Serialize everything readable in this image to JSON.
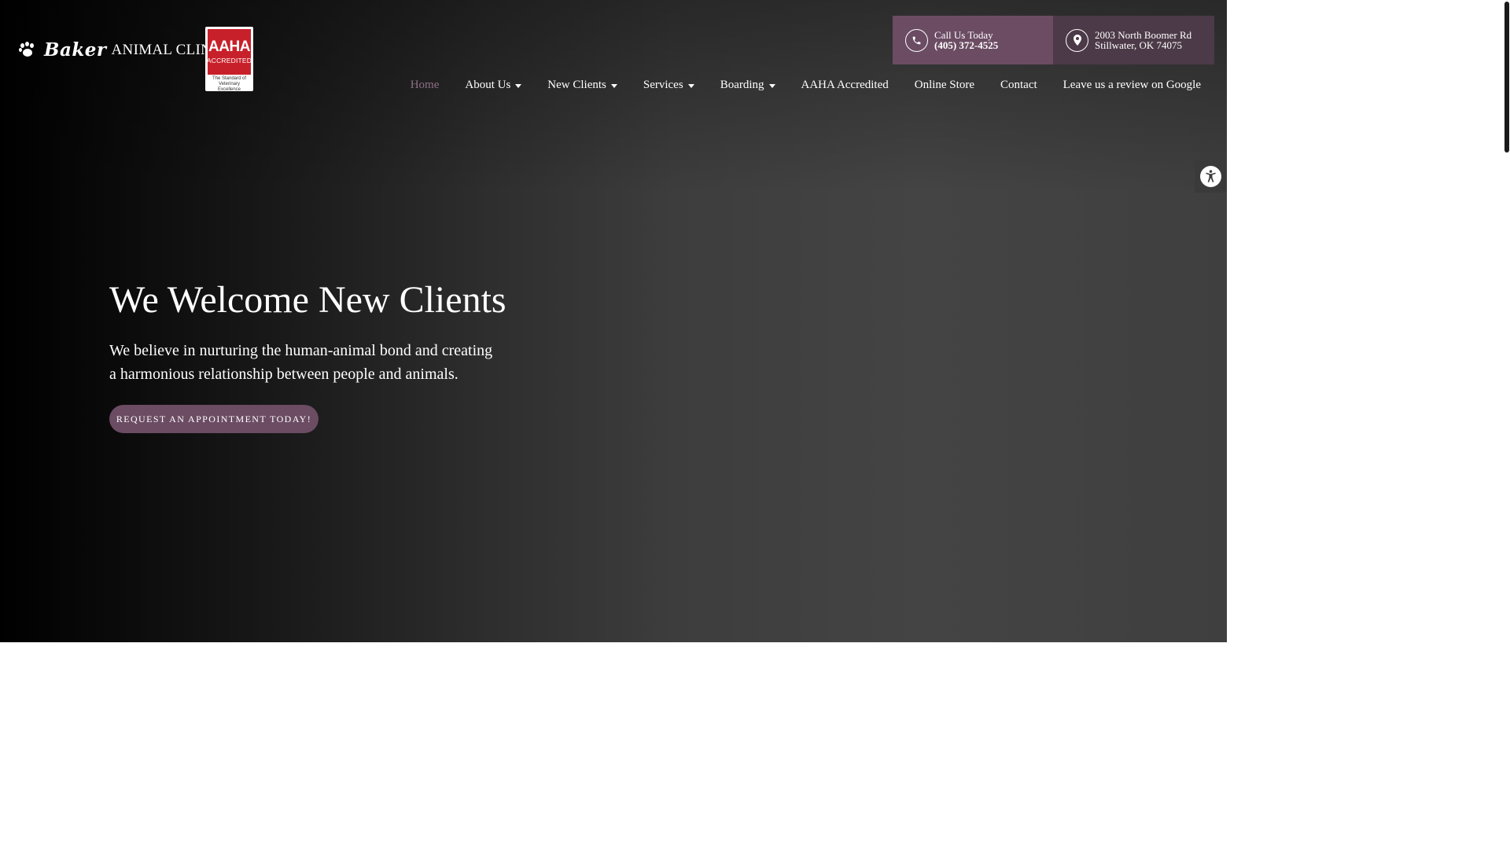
{
  "logo": {
    "script": "Baker",
    "text": "ANIMAL CLINIC",
    "badge_word": "AAHA",
    "badge_accredited": "ACCREDITED",
    "badge_tagline": "The Standard of Veterinary Excellence",
    "badge_red": "#c8202a"
  },
  "contact": {
    "phone_label": "Call Us Today",
    "phone_number": "(405) 372-4525",
    "address_line1": "2003 North Boomer Rd",
    "address_line2": "Stillwater, OK 74075",
    "phone_icon": "phone-icon",
    "address_icon": "map-pin-icon"
  },
  "nav": {
    "items": [
      {
        "label": "Home",
        "dropdown": false,
        "active": true
      },
      {
        "label": "About Us",
        "dropdown": true,
        "active": false
      },
      {
        "label": "New Clients",
        "dropdown": true,
        "active": false
      },
      {
        "label": "Services",
        "dropdown": true,
        "active": false
      },
      {
        "label": "Boarding",
        "dropdown": true,
        "active": false
      },
      {
        "label": "AAHA Accredited",
        "dropdown": false,
        "active": false
      },
      {
        "label": "Online Store",
        "dropdown": false,
        "active": false
      },
      {
        "label": "Contact",
        "dropdown": false,
        "active": false
      },
      {
        "label": "Leave us a review on Google",
        "dropdown": false,
        "active": false
      }
    ]
  },
  "hero": {
    "title": "We Welcome New Clients",
    "description": "We believe in nurturing the human-animal bond and creating a harmonious relationship between people and animals.",
    "cta_label": "REQUEST AN APPOINTMENT TODAY!"
  },
  "accessibility": {
    "icon": "accessibility-icon"
  },
  "colors": {
    "accent": "#6b4c63",
    "accent_dark": "#4c3a48",
    "nav_active": "#8e6f87"
  }
}
